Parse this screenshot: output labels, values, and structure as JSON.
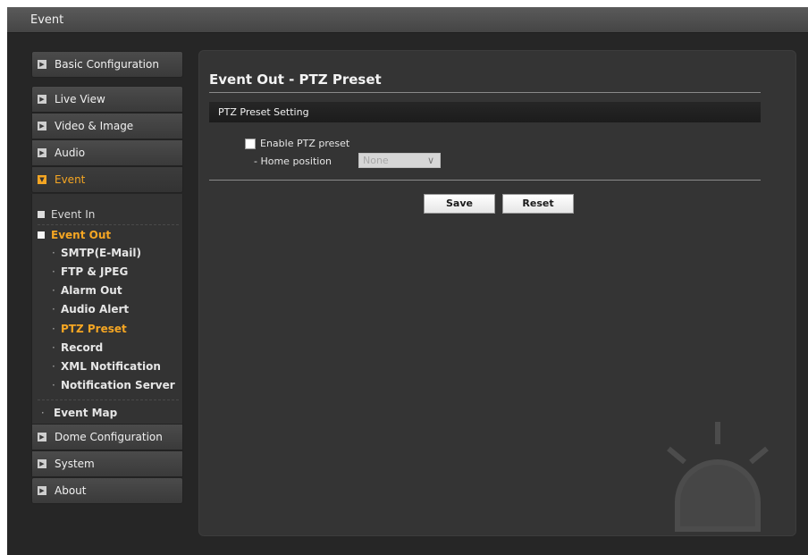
{
  "window": {
    "title": "Event"
  },
  "sidebar": {
    "top": [
      {
        "label": "Basic Configuration"
      }
    ],
    "group": [
      {
        "label": "Live View"
      },
      {
        "label": "Video & Image"
      },
      {
        "label": "Audio"
      },
      {
        "label": "Event"
      }
    ],
    "event_sub": {
      "event_in": "Event In",
      "event_out": "Event Out",
      "event_out_items": [
        "SMTP(E-Mail)",
        "FTP & JPEG",
        "Alarm Out",
        "Audio Alert",
        "PTZ Preset",
        "Record",
        "XML Notification",
        "Notification Server"
      ],
      "event_map": "Event Map"
    },
    "bottom": [
      {
        "label": "Dome Configuration"
      },
      {
        "label": "System"
      },
      {
        "label": "About"
      }
    ]
  },
  "main": {
    "title": "Event Out - PTZ Preset",
    "section_title": "PTZ Preset Setting",
    "enable_label": "Enable PTZ preset",
    "enable_checked": false,
    "home_position_label": "- Home position",
    "home_position_value": "None",
    "save_label": "Save",
    "reset_label": "Reset"
  },
  "colors": {
    "accent": "#f5a623",
    "background": "#262626",
    "panel": "#343434"
  },
  "icons": [
    "arrow-right-icon",
    "chevron-down-icon",
    "square-bullet-icon",
    "alarm-light-watermark-icon"
  ]
}
